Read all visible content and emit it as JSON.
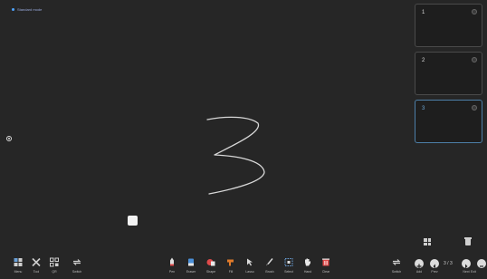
{
  "app": {
    "mode_label": "Standard mode",
    "accent_color": "#4da3ff"
  },
  "canvas": {
    "drawn_content": "3",
    "stroke_color": "#d8d8d8"
  },
  "pages": [
    {
      "label": "1",
      "active": false
    },
    {
      "label": "2",
      "active": false
    },
    {
      "label": "3",
      "active": true
    }
  ],
  "left_tools": [
    {
      "label": "Menu",
      "icon": "menu-icon"
    },
    {
      "label": "Tool",
      "icon": "tools-icon"
    },
    {
      "label": "QR",
      "icon": "qr-icon"
    },
    {
      "label": "Switch",
      "icon": "switch-icon"
    }
  ],
  "center_tools": [
    {
      "label": "Pen",
      "icon": "pen-icon"
    },
    {
      "label": "Eraser",
      "icon": "eraser-icon"
    },
    {
      "label": "Shape",
      "icon": "shape-icon"
    },
    {
      "label": "Fill",
      "icon": "fill-icon"
    },
    {
      "label": "Lasso",
      "icon": "lasso-icon"
    },
    {
      "label": "Brush",
      "icon": "brush-icon"
    },
    {
      "label": "Select",
      "icon": "select-icon"
    },
    {
      "label": "Hand",
      "icon": "hand-icon"
    },
    {
      "label": "Clear",
      "icon": "clear-icon"
    }
  ],
  "right_tools": {
    "switch_label": "Switch",
    "add_label": "Add",
    "prev_label": "Prev",
    "next_label": "Next",
    "exit_label": "Exit",
    "page_counter": "3 / 3"
  }
}
